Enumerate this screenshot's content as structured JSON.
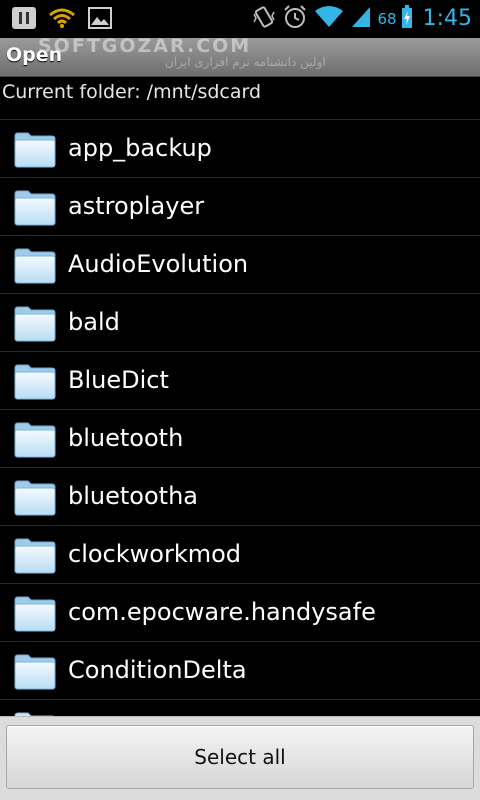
{
  "status_bar": {
    "time": "1:45",
    "battery_percent": "68",
    "accent_color": "#33b5e5",
    "icons": [
      "pause-icon",
      "wifi-alert-icon",
      "image-icon",
      "vibrate-icon",
      "alarm-icon",
      "wifi-icon",
      "signal-icon",
      "battery-charging-icon"
    ]
  },
  "title_bar": {
    "title": "Open",
    "watermark": "SOFTGOZAR.COM",
    "watermark_sub": "اولین دانشنامه نرم افزاری ایران"
  },
  "current_folder": {
    "label": "Current folder: /mnt/sdcard"
  },
  "folders": [
    {
      "name": "app_backup"
    },
    {
      "name": "astroplayer"
    },
    {
      "name": "AudioEvolution"
    },
    {
      "name": "bald"
    },
    {
      "name": "BlueDict"
    },
    {
      "name": "bluetooth"
    },
    {
      "name": "bluetootha"
    },
    {
      "name": "clockworkmod"
    },
    {
      "name": "com.epocware.handysafe"
    },
    {
      "name": "ConditionDelta"
    }
  ],
  "actions": {
    "select_all_label": "Select all"
  }
}
